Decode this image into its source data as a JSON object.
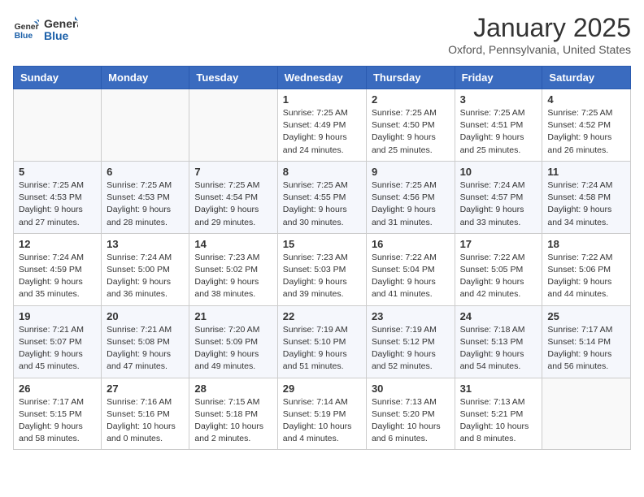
{
  "logo": {
    "line1": "General",
    "line2": "Blue"
  },
  "title": "January 2025",
  "location": "Oxford, Pennsylvania, United States",
  "weekdays": [
    "Sunday",
    "Monday",
    "Tuesday",
    "Wednesday",
    "Thursday",
    "Friday",
    "Saturday"
  ],
  "weeks": [
    [
      {
        "day": "",
        "info": ""
      },
      {
        "day": "",
        "info": ""
      },
      {
        "day": "",
        "info": ""
      },
      {
        "day": "1",
        "info": "Sunrise: 7:25 AM\nSunset: 4:49 PM\nDaylight: 9 hours\nand 24 minutes."
      },
      {
        "day": "2",
        "info": "Sunrise: 7:25 AM\nSunset: 4:50 PM\nDaylight: 9 hours\nand 25 minutes."
      },
      {
        "day": "3",
        "info": "Sunrise: 7:25 AM\nSunset: 4:51 PM\nDaylight: 9 hours\nand 25 minutes."
      },
      {
        "day": "4",
        "info": "Sunrise: 7:25 AM\nSunset: 4:52 PM\nDaylight: 9 hours\nand 26 minutes."
      }
    ],
    [
      {
        "day": "5",
        "info": "Sunrise: 7:25 AM\nSunset: 4:53 PM\nDaylight: 9 hours\nand 27 minutes."
      },
      {
        "day": "6",
        "info": "Sunrise: 7:25 AM\nSunset: 4:53 PM\nDaylight: 9 hours\nand 28 minutes."
      },
      {
        "day": "7",
        "info": "Sunrise: 7:25 AM\nSunset: 4:54 PM\nDaylight: 9 hours\nand 29 minutes."
      },
      {
        "day": "8",
        "info": "Sunrise: 7:25 AM\nSunset: 4:55 PM\nDaylight: 9 hours\nand 30 minutes."
      },
      {
        "day": "9",
        "info": "Sunrise: 7:25 AM\nSunset: 4:56 PM\nDaylight: 9 hours\nand 31 minutes."
      },
      {
        "day": "10",
        "info": "Sunrise: 7:24 AM\nSunset: 4:57 PM\nDaylight: 9 hours\nand 33 minutes."
      },
      {
        "day": "11",
        "info": "Sunrise: 7:24 AM\nSunset: 4:58 PM\nDaylight: 9 hours\nand 34 minutes."
      }
    ],
    [
      {
        "day": "12",
        "info": "Sunrise: 7:24 AM\nSunset: 4:59 PM\nDaylight: 9 hours\nand 35 minutes."
      },
      {
        "day": "13",
        "info": "Sunrise: 7:24 AM\nSunset: 5:00 PM\nDaylight: 9 hours\nand 36 minutes."
      },
      {
        "day": "14",
        "info": "Sunrise: 7:23 AM\nSunset: 5:02 PM\nDaylight: 9 hours\nand 38 minutes."
      },
      {
        "day": "15",
        "info": "Sunrise: 7:23 AM\nSunset: 5:03 PM\nDaylight: 9 hours\nand 39 minutes."
      },
      {
        "day": "16",
        "info": "Sunrise: 7:22 AM\nSunset: 5:04 PM\nDaylight: 9 hours\nand 41 minutes."
      },
      {
        "day": "17",
        "info": "Sunrise: 7:22 AM\nSunset: 5:05 PM\nDaylight: 9 hours\nand 42 minutes."
      },
      {
        "day": "18",
        "info": "Sunrise: 7:22 AM\nSunset: 5:06 PM\nDaylight: 9 hours\nand 44 minutes."
      }
    ],
    [
      {
        "day": "19",
        "info": "Sunrise: 7:21 AM\nSunset: 5:07 PM\nDaylight: 9 hours\nand 45 minutes."
      },
      {
        "day": "20",
        "info": "Sunrise: 7:21 AM\nSunset: 5:08 PM\nDaylight: 9 hours\nand 47 minutes."
      },
      {
        "day": "21",
        "info": "Sunrise: 7:20 AM\nSunset: 5:09 PM\nDaylight: 9 hours\nand 49 minutes."
      },
      {
        "day": "22",
        "info": "Sunrise: 7:19 AM\nSunset: 5:10 PM\nDaylight: 9 hours\nand 51 minutes."
      },
      {
        "day": "23",
        "info": "Sunrise: 7:19 AM\nSunset: 5:12 PM\nDaylight: 9 hours\nand 52 minutes."
      },
      {
        "day": "24",
        "info": "Sunrise: 7:18 AM\nSunset: 5:13 PM\nDaylight: 9 hours\nand 54 minutes."
      },
      {
        "day": "25",
        "info": "Sunrise: 7:17 AM\nSunset: 5:14 PM\nDaylight: 9 hours\nand 56 minutes."
      }
    ],
    [
      {
        "day": "26",
        "info": "Sunrise: 7:17 AM\nSunset: 5:15 PM\nDaylight: 9 hours\nand 58 minutes."
      },
      {
        "day": "27",
        "info": "Sunrise: 7:16 AM\nSunset: 5:16 PM\nDaylight: 10 hours\nand 0 minutes."
      },
      {
        "day": "28",
        "info": "Sunrise: 7:15 AM\nSunset: 5:18 PM\nDaylight: 10 hours\nand 2 minutes."
      },
      {
        "day": "29",
        "info": "Sunrise: 7:14 AM\nSunset: 5:19 PM\nDaylight: 10 hours\nand 4 minutes."
      },
      {
        "day": "30",
        "info": "Sunrise: 7:13 AM\nSunset: 5:20 PM\nDaylight: 10 hours\nand 6 minutes."
      },
      {
        "day": "31",
        "info": "Sunrise: 7:13 AM\nSunset: 5:21 PM\nDaylight: 10 hours\nand 8 minutes."
      },
      {
        "day": "",
        "info": ""
      }
    ]
  ]
}
